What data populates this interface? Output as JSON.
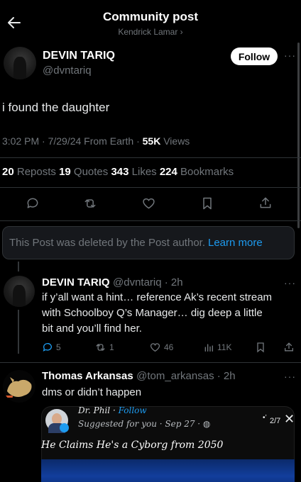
{
  "header": {
    "title": "Community post",
    "subtitle": "Kendrick Lamar ›"
  },
  "post": {
    "author_name": "DEVIN TARIQ",
    "author_handle": "@dvntariq",
    "follow_label": "Follow",
    "more": "···",
    "text": "i found the daughter",
    "time": "3:02 PM · 7/29/24 From Earth · ",
    "views_count": "55K",
    "views_label": " Views",
    "stats": {
      "reposts_count": "20",
      "reposts_label": " Reposts ",
      "quotes_count": "19",
      "quotes_label": " Quotes ",
      "likes_count": "343",
      "likes_label": " Likes ",
      "bookmarks_count": "224",
      "bookmarks_label": " Bookmarks"
    }
  },
  "deleted_notice": {
    "text": "This Post was deleted by the Post author.",
    "link": "Learn more"
  },
  "replies": [
    {
      "author_name": "DEVIN TARIQ",
      "author_handle": "@dvntariq · 2h",
      "more": "···",
      "body_1": "if y’all want a hint… reference Ak’s recent stream",
      "body_2": "with Schoolboy Q’s Manager… dig deep a little",
      "body_3": "bit and you’ll find her.",
      "replies_count": "5",
      "reposts_count": "1",
      "likes_count": "46",
      "views_count": "11K"
    },
    {
      "author_name": "Thomas Arkansas",
      "author_handle": "@tom_arkansas · 2h",
      "more": "···",
      "body_1": "dms or didn’t happen"
    }
  ],
  "embed": {
    "name": "Dr. Phil · ",
    "follow": "Follow",
    "suggested": "Suggested for you · Sep 27 · ",
    "count": "2/7",
    "close": "✕",
    "caption": "He Claims He's a Cyborg from 2050"
  },
  "colors": {
    "accent": "#1d9bf0",
    "muted": "#71767b",
    "background": "#000000",
    "divider": "#2f3336"
  }
}
